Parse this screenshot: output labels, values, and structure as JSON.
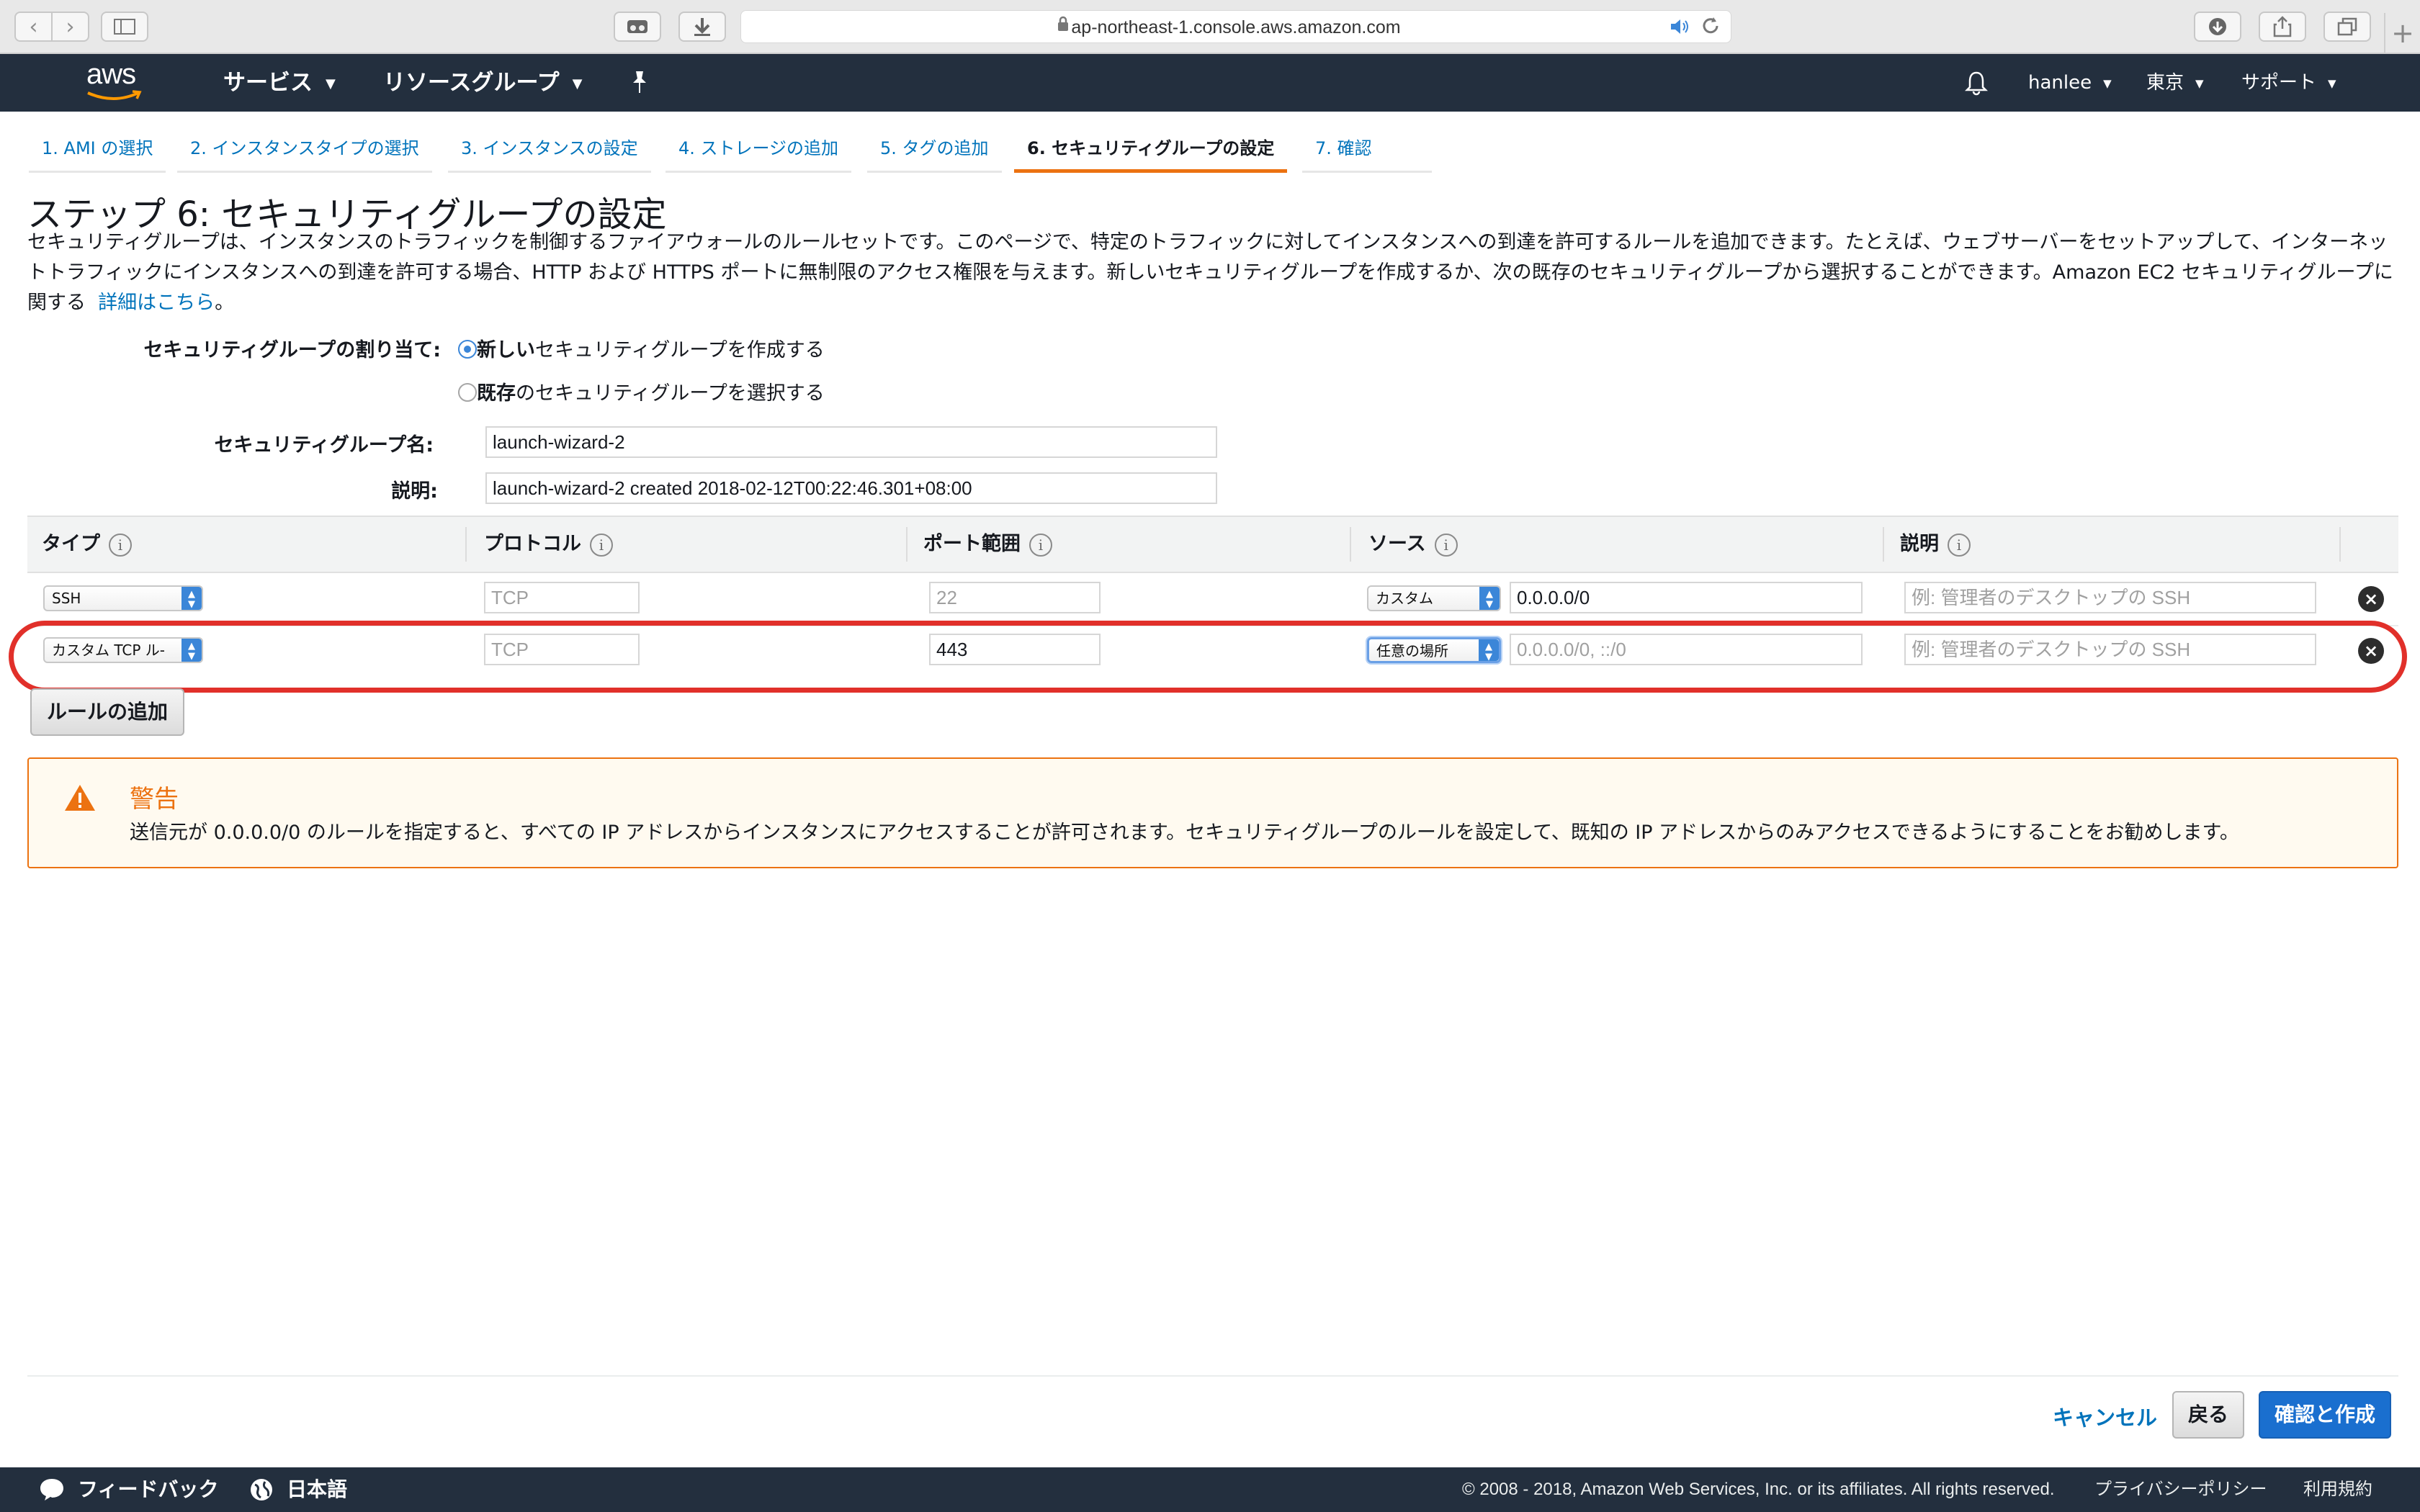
{
  "browser": {
    "url": "ap-northeast-1.console.aws.amazon.com"
  },
  "aws_nav": {
    "logo": "aws",
    "services": "サービス",
    "resource_groups": "リソースグループ",
    "user": "hanlee",
    "region": "東京",
    "support": "サポート"
  },
  "tabs": [
    {
      "label": "1. AMI の選択"
    },
    {
      "label": "2. インスタンスタイプの選択"
    },
    {
      "label": "3. インスタンスの設定"
    },
    {
      "label": "4. ストレージの追加"
    },
    {
      "label": "5. タグの追加"
    },
    {
      "label": "6. セキュリティグループの設定"
    },
    {
      "label": "7. 確認"
    }
  ],
  "page": {
    "title": "ステップ 6: セキュリティグループの設定",
    "description": "セキュリティグループは、インスタンスのトラフィックを制御するファイアウォールのルールセットです。このページで、特定のトラフィックに対してインスタンスへの到達を許可するルールを追加できます。たとえば、ウェブサーバーをセットアップして、インターネットトラフィックにインスタンスへの到達を許可する場合、HTTP および HTTPS ポートに無制限のアクセス権限を与えます。新しいセキュリティグループを作成するか、次の既存のセキュリティグループから選択することができます。Amazon EC2 セキュリティグループに関する",
    "details_link": "詳細はこちら",
    "period": "。"
  },
  "form": {
    "assign_label": "セキュリティグループの割り当て:",
    "option_new_bold": "新しい",
    "option_new_rest": "セキュリティグループを作成する",
    "option_existing_bold": "既存",
    "option_existing_rest": "のセキュリティグループを選択する",
    "name_label": "セキュリティグループ名:",
    "name_value": "launch-wizard-2",
    "desc_label": "説明:",
    "desc_value": "launch-wizard-2 created 2018-02-12T00:22:46.301+08:00"
  },
  "table": {
    "headers": {
      "type": "タイプ",
      "protocol": "プロトコル",
      "port_range": "ポート範囲",
      "source": "ソース",
      "description": "説明"
    },
    "rows": [
      {
        "type": "SSH",
        "protocol": "TCP",
        "port": "22",
        "source_select": "カスタム",
        "source_value": "0.0.0.0/0",
        "desc_placeholder": "例: 管理者のデスクトップの SSH"
      },
      {
        "type": "カスタム TCP ル-",
        "protocol": "TCP",
        "port": "443",
        "source_select": "任意の場所",
        "source_value": "0.0.0.0/0, ::/0",
        "desc_placeholder": "例: 管理者のデスクトップの SSH"
      }
    ],
    "add_rule": "ルールの追加"
  },
  "warning": {
    "title": "警告",
    "text": "送信元が 0.0.0.0/0 のルールを指定すると、すべての IP アドレスからインスタンスにアクセスすることが許可されます。セキュリティグループのルールを設定して、既知の IP アドレスからのみアクセスできるようにすることをお勧めします。"
  },
  "actions": {
    "cancel": "キャンセル",
    "back": "戻る",
    "review_launch": "確認と作成"
  },
  "footer": {
    "feedback": "フィードバック",
    "language": "日本語",
    "copyright": "© 2008 - 2018, Amazon Web Services, Inc. or its affiliates. All rights reserved.",
    "privacy": "プライバシーポリシー",
    "terms": "利用規約"
  },
  "colors": {
    "nav_bg": "#232f3e",
    "link": "#0073bb",
    "accent": "#ec7211",
    "primary": "#1a6fcf",
    "highlight": "#e1302a"
  }
}
